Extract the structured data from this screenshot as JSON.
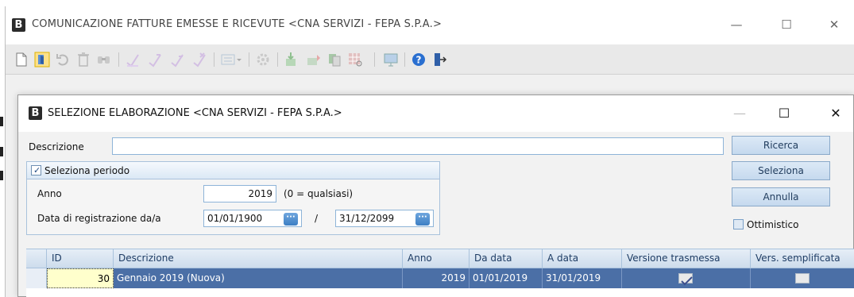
{
  "main_window": {
    "badge": "B",
    "title": "COMUNICAZIONE FATTURE EMESSE E RICEVUTE <CNA SERVIZI - FEPA S.P.A.>",
    "controls": {
      "minimize": "—",
      "maximize": "☐",
      "close": "✕"
    }
  },
  "toolbar": {
    "icons": [
      "new-document-icon",
      "open-folder-icon",
      "undo-icon",
      "delete-icon",
      "find-icon",
      "edit-icon-1",
      "edit-icon-2",
      "edit-icon-3",
      "edit-cancel-icon",
      "list-dropdown-icon",
      "settings-icon",
      "import-icon",
      "export-icon",
      "copy-icon",
      "report-icon",
      "monitor-icon",
      "help-icon",
      "exit-icon"
    ]
  },
  "dialog": {
    "badge": "B",
    "title": "SELEZIONE ELABORAZIONE <CNA SERVIZI - FEPA S.P.A.>",
    "controls": {
      "minimize": "—",
      "maximize": "☐",
      "close": "✕"
    },
    "descrizione_label": "Descrizione",
    "descrizione_value": "",
    "buttons": {
      "ricerca": "Ricerca",
      "seleziona": "Seleziona",
      "annulla": "Annulla"
    },
    "ottimistico_label": "Ottimistico",
    "ottimistico_checked": false,
    "periodo": {
      "checkbox_label": "Seleziona periodo",
      "checked": true,
      "anno_label": "Anno",
      "anno_value": "2019",
      "anno_hint": "(0 = qualsiasi)",
      "data_label": "Data di registrazione da/a",
      "data_da": "01/01/1900",
      "separator": "/",
      "data_a": "31/12/2099",
      "date_button_glyph": "···"
    }
  },
  "grid": {
    "columns": [
      "ID",
      "Descrizione",
      "Anno",
      "Da data",
      "A data",
      "Versione trasmessa",
      "Vers. semplificata"
    ],
    "rows": [
      {
        "id": "30",
        "descrizione": "Gennaio 2019 (Nuova)",
        "anno": "2019",
        "da_data": "01/01/2019",
        "a_data": "31/01/2019",
        "versione_trasmessa": true,
        "vers_semplificata": false
      }
    ]
  },
  "colors": {
    "selected_row": "#4b6fa6",
    "button_text": "#1f3b5c",
    "border_blue": "#a9c2dc"
  }
}
